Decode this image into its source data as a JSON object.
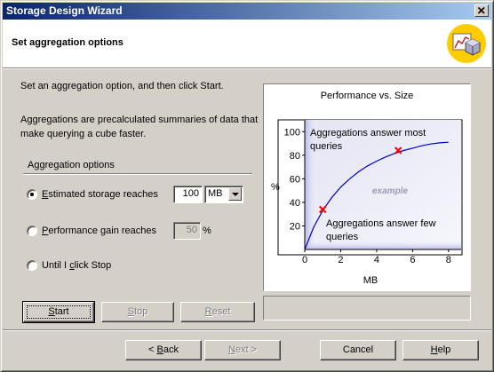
{
  "window": {
    "title": "Storage Design Wizard"
  },
  "header": {
    "title": "Set aggregation options",
    "icon": "cube-chart-icon"
  },
  "instructions": {
    "line1": "Set an aggregation option, and then click Start.",
    "desc1": "Aggregations are precalculated summaries of data that",
    "desc2": "make querying a cube faster."
  },
  "options": {
    "group_label": "Aggregation options",
    "estimated": {
      "label_first": "E",
      "label_rest": "stimated storage reaches",
      "value": "100",
      "unit": "MB",
      "selected": true
    },
    "performance": {
      "label_first": "P",
      "label_rest": "erformance gain reaches",
      "value": "50",
      "unit": "%",
      "selected": false
    },
    "until": {
      "label_pre": "Until I ",
      "label_ul": "c",
      "label_post": "lick Stop",
      "selected": false
    }
  },
  "actions": {
    "start": {
      "ul": "S",
      "rest": "tart"
    },
    "stop": {
      "ul": "S",
      "rest": "top"
    },
    "reset": {
      "ul": "R",
      "rest": "eset"
    }
  },
  "footer": {
    "back": {
      "pre": "< ",
      "ul": "B",
      "rest": "ack"
    },
    "next": {
      "ul": "N",
      "rest": "ext >"
    },
    "cancel": "Cancel",
    "help": {
      "ul": "H",
      "rest": "elp"
    }
  },
  "chart_data": {
    "type": "line",
    "title": "Performance vs. Size",
    "xlabel": "MB",
    "ylabel": "%",
    "xlim": [
      0,
      8.7
    ],
    "ylim": [
      0,
      110
    ],
    "xticks": [
      0,
      2,
      4,
      6,
      8
    ],
    "yticks": [
      20,
      40,
      60,
      80,
      100
    ],
    "series": [
      {
        "x": [
          0,
          0.5,
          1,
          1.5,
          2,
          2.5,
          3,
          3.5,
          4,
          4.5,
          5,
          5.5,
          6,
          6.5,
          7,
          7.5,
          8
        ],
        "values": [
          0,
          19,
          33,
          44,
          53,
          60,
          66,
          71,
          75,
          78.5,
          81.5,
          84,
          86,
          88,
          89.5,
          90.5,
          91
        ]
      }
    ],
    "markers": [
      {
        "x": 1,
        "y": 34
      },
      {
        "x": 5.2,
        "y": 84
      }
    ],
    "annotations": {
      "top": [
        "Aggregations answer most",
        "queries"
      ],
      "bottom": [
        "Aggregations answer few",
        "queries"
      ],
      "watermark": "example"
    },
    "colors": {
      "line": "#0000c0",
      "marker": "#ff0000",
      "shade": "#ccccf0"
    }
  }
}
